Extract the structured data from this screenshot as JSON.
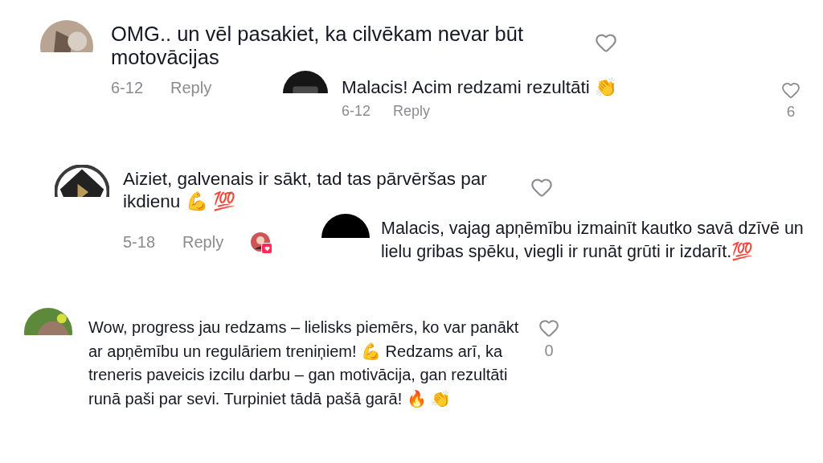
{
  "comments": [
    {
      "text": "OMG.. un vēl pasakiet, ka cilvēkam nevar būt motovācijas",
      "date": "6-12",
      "reply": "Reply",
      "liked": false
    },
    {
      "text": "Malacis! Acim redzami rezultāti 👏",
      "date": "6-12",
      "reply": "Reply",
      "liked": false,
      "likes": "6"
    },
    {
      "text": "Aiziet, galvenais ir sākt, tad tas pārvēršas par ikdienu 💪 💯",
      "date": "5-18",
      "reply": "Reply",
      "liked": false,
      "creator_liked": true
    },
    {
      "text": "Malacis, vajag apņēmību izmainīt kautko savā dzīvē un lielu gribas spēku, viegli ir runāt grūti ir izdarīt.💯"
    },
    {
      "text": "Wow, progress jau redzams – lielisks piemērs, ko var panākt ar apņēmību un regulāriem treniņiem! 💪 Redzams arī, ka treneris paveicis izcilu darbu – gan motivācija, gan rezultāti runā paši par sevi. Turpiniet tādā pašā garā! 🔥 👏",
      "liked": false,
      "likes": "0"
    }
  ]
}
